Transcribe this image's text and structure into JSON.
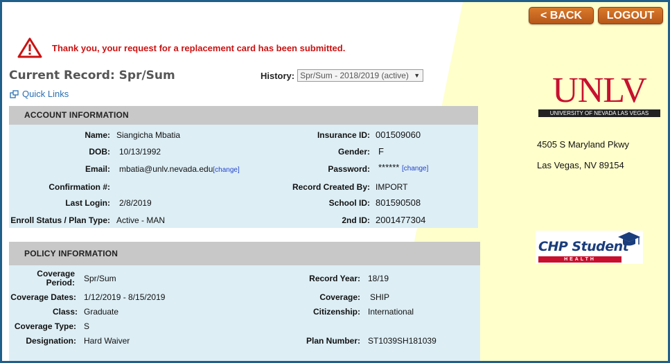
{
  "nav": {
    "back_label": "< BACK",
    "logout_label": "LOGOUT"
  },
  "alert": {
    "message": "Thank you, your request for a replacement card has been submitted."
  },
  "page": {
    "title": "Current Record: Spr/Sum",
    "quick_links": "Quick Links"
  },
  "history": {
    "label": "History:",
    "selected": "Spr/Sum - 2018/2019 (active)"
  },
  "account": {
    "header": "ACCOUNT INFORMATION",
    "name_label": "Name:",
    "name": "Siangicha  Mbatia",
    "dob_label": "DOB:",
    "dob": "10/13/1992",
    "email_label": "Email:",
    "email": "mbatia@unlv.nevada.edu",
    "email_change": "[change]",
    "confirmation_label": "Confirmation #:",
    "confirmation": "",
    "last_login_label": "Last Login:",
    "last_login": "2/8/2019",
    "enroll_label": "Enroll Status / Plan Type:",
    "enroll": "Active - MAN",
    "insurance_label": "Insurance ID:",
    "insurance": "001509060",
    "gender_label": "Gender:",
    "gender": "F",
    "password_label": "Password:",
    "password": "******",
    "password_change": "[change]",
    "created_label": "Record Created By:",
    "created": "IMPORT",
    "school_label": "School ID:",
    "school": "801590508",
    "second_label": "2nd ID:",
    "second": "2001477304"
  },
  "policy": {
    "header": "POLICY INFORMATION",
    "period_label_1": "Coverage",
    "period_label_2": "Period:",
    "period": "Spr/Sum",
    "dates_label": "Coverage Dates:",
    "dates": "1/12/2019 - 8/15/2019",
    "class_label": "Class:",
    "class": "Graduate",
    "type_label": "Coverage Type:",
    "type": "S",
    "designation_label": "Designation:",
    "designation": "Hard Waiver",
    "year_label": "Record Year:",
    "year": "18/19",
    "coverage_label": "Coverage:",
    "coverage": "SHIP",
    "citizenship_label": "Citizenship:",
    "citizenship": "International",
    "plan_label": "Plan Number:",
    "plan": "ST1039SH181039"
  },
  "sidebar": {
    "logo_text": "UNLV",
    "logo_subtext": "UNIVERSITY OF NEVADA LAS VEGAS",
    "address_line1": "4505 S Maryland Pkwy",
    "address_line2": "Las Vegas, NV 89154",
    "chp_text": "CHP Student",
    "chp_sub": "HEALTH"
  },
  "colors": {
    "alert_red": "#cc1111",
    "button_orange": "#c8651f",
    "link_blue": "#2a6fb0",
    "unlv_red": "#c8102e"
  }
}
